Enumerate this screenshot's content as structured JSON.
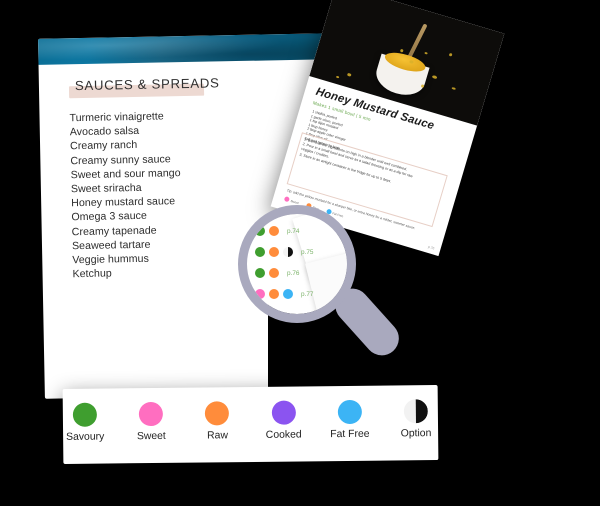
{
  "page": {
    "banner_color": "#0d78a3",
    "title": "SAUCES & SPREADS",
    "title_highlight_color": "#edd9d2"
  },
  "legend_colors": {
    "savoury": "#3f9e2f",
    "sweet": "#ff6ec0",
    "raw": "#ff8c3b",
    "cooked": "#8b54f0",
    "fat_free": "#3cb4f5",
    "option": "#111111"
  },
  "legend": {
    "items": [
      {
        "label": "Savoury",
        "color": "#3f9e2f",
        "icon": "circle-icon"
      },
      {
        "label": "Sweet",
        "color": "#ff6ec0",
        "icon": "circle-icon"
      },
      {
        "label": "Raw",
        "color": "#ff8c3b",
        "icon": "circle-icon"
      },
      {
        "label": "Cooked",
        "color": "#8b54f0",
        "icon": "circle-icon"
      },
      {
        "label": "Fat Free",
        "color": "#3cb4f5",
        "icon": "circle-icon"
      },
      {
        "label": "Option",
        "color": "#111111",
        "icon": "half-circle-icon"
      }
    ]
  },
  "recipe_list": [
    {
      "name": "Turmeric vinaigrette",
      "dots": [
        "#ff6ec0",
        "#ff8c3b",
        "#3cb4f5"
      ]
    },
    {
      "name": "Avocado salsa",
      "dots": [
        "#3f9e2f",
        "#ff8c3b"
      ]
    },
    {
      "name": "Creamy ranch",
      "dots": [
        "#3f9e2f",
        "#ff8c3b"
      ]
    },
    {
      "name": "Creamy sunny sauce",
      "dots": [
        "#ff6ec0",
        "#ff8c3b"
      ]
    },
    {
      "name": "Sweet and sour mango",
      "dots": [
        "#ff6ec0",
        "#ff8c3b"
      ]
    },
    {
      "name": "Sweet sriracha",
      "dots": [
        "#ff6ec0"
      ]
    },
    {
      "name": "Honey mustard sauce",
      "dots": [
        "#ff6ec0"
      ]
    },
    {
      "name": "Omega 3 sauce",
      "dots": [
        "#3f9e2f",
        "#ff8c3b"
      ]
    },
    {
      "name": "Creamy tapenade",
      "dots": [
        "#3f9e2f",
        "#ff8c3b"
      ]
    },
    {
      "name": "Seaweed tartare",
      "dots": [
        "#3f9e2f",
        "#ff8c3b",
        "#111111"
      ]
    },
    {
      "name": "Veggie hummus",
      "dots": [
        "#3f9e2f",
        "#ff8c3b"
      ]
    },
    {
      "name": "Ketchup",
      "dots": [
        "#ff6ec0",
        "#ff8c3b",
        "#3cb4f5"
      ]
    }
  ],
  "magnifier": {
    "ring_color": "#a9a9be",
    "rows": [
      {
        "page": "p.74",
        "dots": [
          "#3f9e2f",
          "#ff8c3b"
        ]
      },
      {
        "page": "p.75",
        "dots": [
          "#3f9e2f",
          "#ff8c3b",
          "option"
        ]
      },
      {
        "page": "p.76",
        "dots": [
          "#3f9e2f",
          "#ff8c3b"
        ]
      },
      {
        "page": "p.77",
        "dots": [
          "#ff6ec0",
          "#ff8c3b",
          "#3cb4f5"
        ]
      }
    ]
  },
  "recipe_card": {
    "title": "Honey Mustard Sauce",
    "subtitle": "Makes 1 small bowl  |  5 min",
    "photo_alt": "bowl-of-honey-mustard-sauce-photo",
    "ingredients": [
      "1 shallot, peeled",
      "1 garlic clove, peeled",
      "1 tsp dijon mustard",
      "1 tbsp honey",
      "2 tbsp apple cider vinegar",
      "1 tbsp olive oil",
      "Salt and pepper to taste"
    ],
    "steps": [
      "1. Blend all the ingredients on high in a blender until well combined.",
      "2. Pour in a small bowl and serve as a salad dressing or as a dip for raw",
      "   veggies / crudites.",
      "3. Store in an airtight container in the fridge for up to 5 days."
    ],
    "note": "Tip: add the yellow mustard for a sharper bite, or extra honey for a milder, sweeter sauce.",
    "footer_dots": [
      {
        "label": "Sweet",
        "color": "#ff6ec0"
      },
      {
        "label": "Raw",
        "color": "#ff8c3b"
      },
      {
        "label": "Fat Free",
        "color": "#3cb4f5"
      }
    ],
    "page_number": "p.76"
  }
}
